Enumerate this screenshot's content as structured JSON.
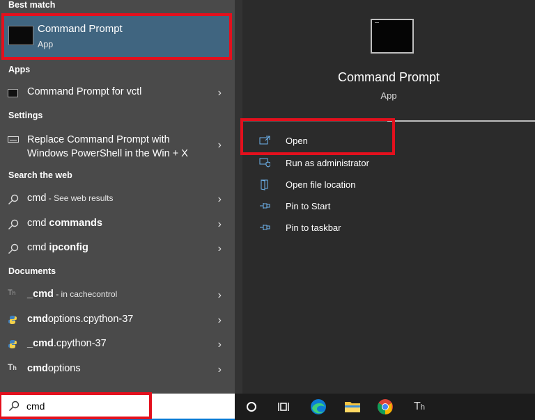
{
  "left": {
    "sections": {
      "best_match": "Best match",
      "apps": "Apps",
      "settings": "Settings",
      "search_web": "Search the web",
      "documents": "Documents"
    },
    "best": {
      "title": "Command Prompt",
      "subtitle": "App"
    },
    "apps": [
      {
        "label": "Command Prompt for vctl"
      }
    ],
    "settings": [
      {
        "line1": "Replace Command Prompt with",
        "line2": "Windows PowerShell in the Win + X"
      }
    ],
    "web": [
      {
        "prefix": "cmd",
        "bold": "",
        "suffix": " - See web results"
      },
      {
        "prefix": "cmd ",
        "bold": "commands",
        "suffix": ""
      },
      {
        "prefix": "cmd ",
        "bold": "ipconfig",
        "suffix": ""
      }
    ],
    "documents": [
      {
        "prefix": "",
        "bold": "_cmd",
        "suffix": " - in cachecontrol",
        "icon": "text-file-icon"
      },
      {
        "prefix": "",
        "bold": "cmd",
        "suffix": "options.cpython-37",
        "icon": "python-file-icon"
      },
      {
        "prefix": "",
        "bold": "_cmd",
        "suffix": ".cpython-37",
        "icon": "python-file-icon"
      },
      {
        "prefix": "",
        "bold": "cmd",
        "suffix": "options",
        "icon": "text-file-icon"
      }
    ]
  },
  "right": {
    "title": "Command Prompt",
    "subtitle": "App",
    "actions": [
      {
        "label": "Open",
        "icon": "open-icon"
      },
      {
        "label": "Run as administrator",
        "icon": "shield-icon"
      },
      {
        "label": "Open file location",
        "icon": "folder-icon"
      },
      {
        "label": "Pin to Start",
        "icon": "pin-icon"
      },
      {
        "label": "Pin to taskbar",
        "icon": "pin-icon"
      }
    ]
  },
  "taskbar": {
    "search_value": "cmd",
    "icons": [
      "cortana-icon",
      "task-view-icon",
      "edge-icon",
      "file-explorer-icon",
      "chrome-icon",
      "typora-icon"
    ]
  },
  "colors": {
    "highlight": "#e3101d",
    "selected": "#406580",
    "accent": "#0078d4"
  }
}
